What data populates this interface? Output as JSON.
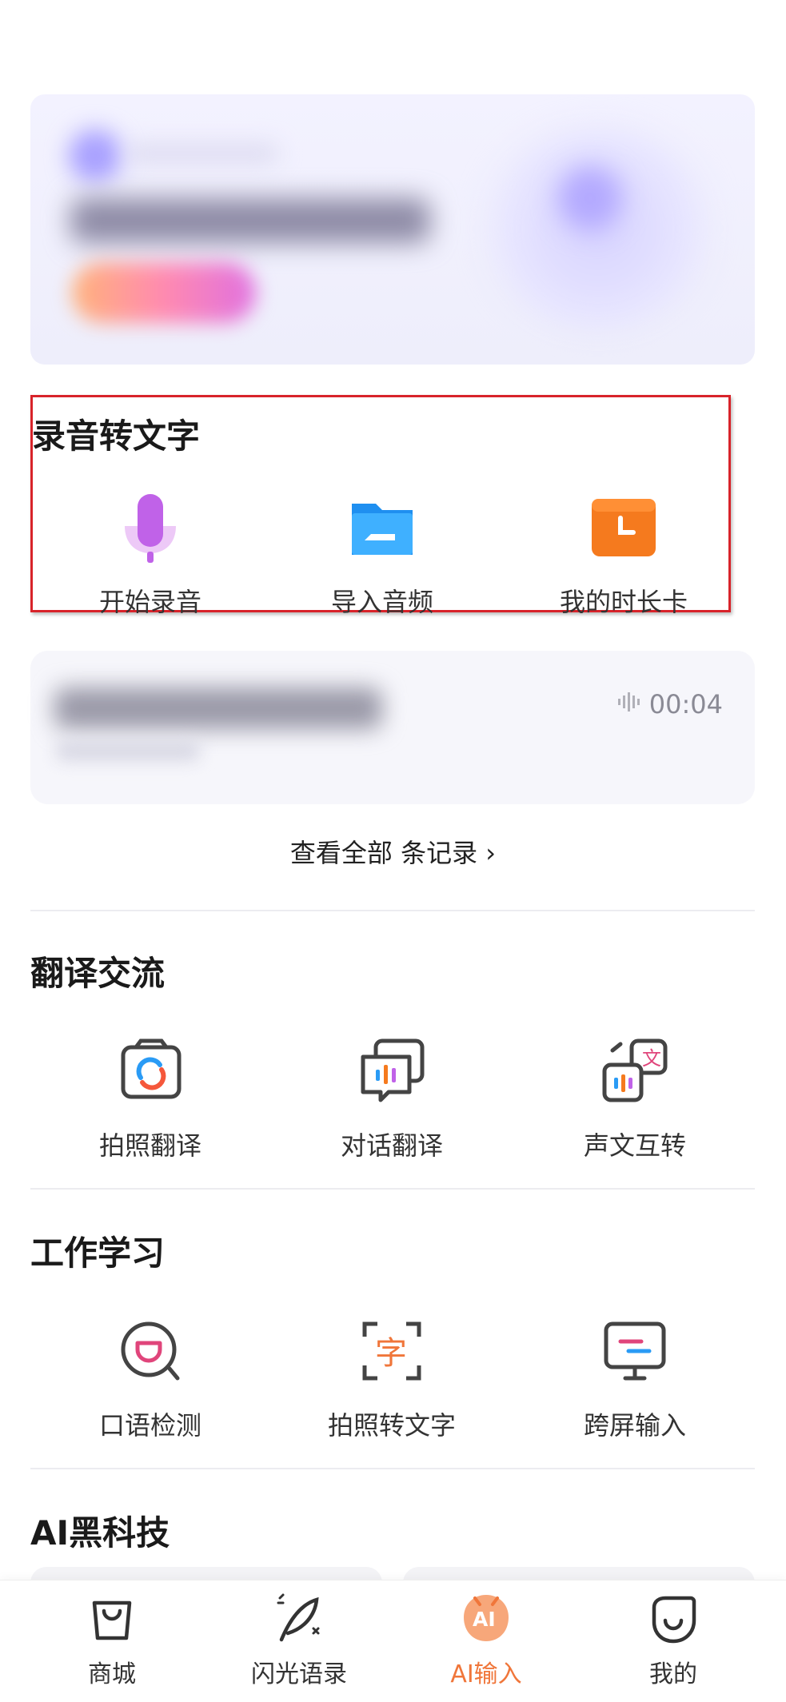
{
  "recording_section": {
    "title": "录音转文字",
    "tools": [
      {
        "label": "开始录音",
        "icon": "microphone-icon"
      },
      {
        "label": "导入音频",
        "icon": "folder-icon"
      },
      {
        "label": "我的时长卡",
        "icon": "clock-icon"
      }
    ]
  },
  "recent_record": {
    "duration": "00:04",
    "duration_icon": "waveform-icon"
  },
  "view_all": {
    "label": "查看全部 条记录 ›"
  },
  "translate_section": {
    "title": "翻译交流",
    "tools": [
      {
        "label": "拍照翻译",
        "icon": "camera-translate-icon"
      },
      {
        "label": "对话翻译",
        "icon": "dialog-translate-icon"
      },
      {
        "label": "声文互转",
        "icon": "voice-text-convert-icon"
      }
    ]
  },
  "work_section": {
    "title": "工作学习",
    "tools": [
      {
        "label": "口语检测",
        "icon": "speech-check-icon"
      },
      {
        "label": "拍照转文字",
        "icon": "scan-text-icon"
      },
      {
        "label": "跨屏输入",
        "icon": "cross-screen-icon"
      }
    ]
  },
  "ai_section": {
    "title": "AI黑科技"
  },
  "tabbar": {
    "tabs": [
      {
        "label": "商城",
        "icon": "shopping-bag-icon",
        "active": false
      },
      {
        "label": "闪光语录",
        "icon": "feather-icon",
        "active": false
      },
      {
        "label": "AI输入",
        "icon": "ai-input-icon",
        "active": true
      },
      {
        "label": "我的",
        "icon": "profile-smile-icon",
        "active": false
      }
    ]
  },
  "colors": {
    "accent": "#f0763a",
    "highlight_border": "#d8232a",
    "mic_purple": "#c062e8",
    "folder_blue": "#2a9bf5",
    "clock_orange": "#f57a1e"
  }
}
